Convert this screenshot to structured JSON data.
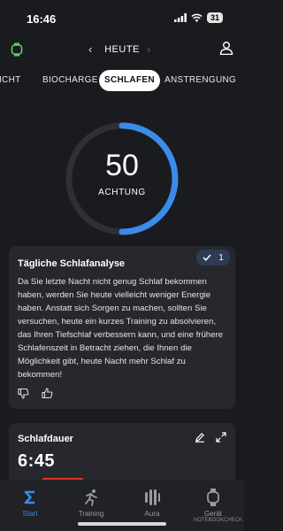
{
  "status_bar": {
    "time": "16:46",
    "battery": "31"
  },
  "top_nav": {
    "date_label": "HEUTE"
  },
  "tabs": [
    {
      "label": "SICHT"
    },
    {
      "label": "BIOCHARGE"
    },
    {
      "label": "SCHLAFEN"
    },
    {
      "label": "ANSTRENGUNG"
    }
  ],
  "active_tab": "SCHLAFEN",
  "gauge": {
    "value": "50",
    "label": "ACHTUNG",
    "fraction": 0.5,
    "accent": "#3b8beb"
  },
  "analysis_card": {
    "title": "Tägliche Schlafanalyse",
    "badge_count": "1",
    "body": "Da Sie letzte Nacht nicht genug Schlaf bekommen haben, werden Sie heute vielleicht weniger Energie haben. Anstatt sich Sorgen zu machen, sollten Sie versuchen, heute ein kurzes Training zu absolvieren, das Ihren Tiefschlaf verbessern kann, und eine frühere Schlafenszeit in Betracht ziehen, die Ihnen die Möglichkeit gibt, heute Nacht mehr Schlaf zu bekommen!"
  },
  "duration_card": {
    "title": "Schlafdauer",
    "value": "6:45",
    "bar_color": "#e0312a"
  },
  "bottom_nav": [
    {
      "label": "Start",
      "icon": "sigma-icon"
    },
    {
      "label": "Training",
      "icon": "runner-icon"
    },
    {
      "label": "Aura",
      "icon": "aura-icon"
    },
    {
      "label": "Gerät",
      "icon": "watch-icon"
    }
  ],
  "watermark": "NOTEBOOKCHECK"
}
